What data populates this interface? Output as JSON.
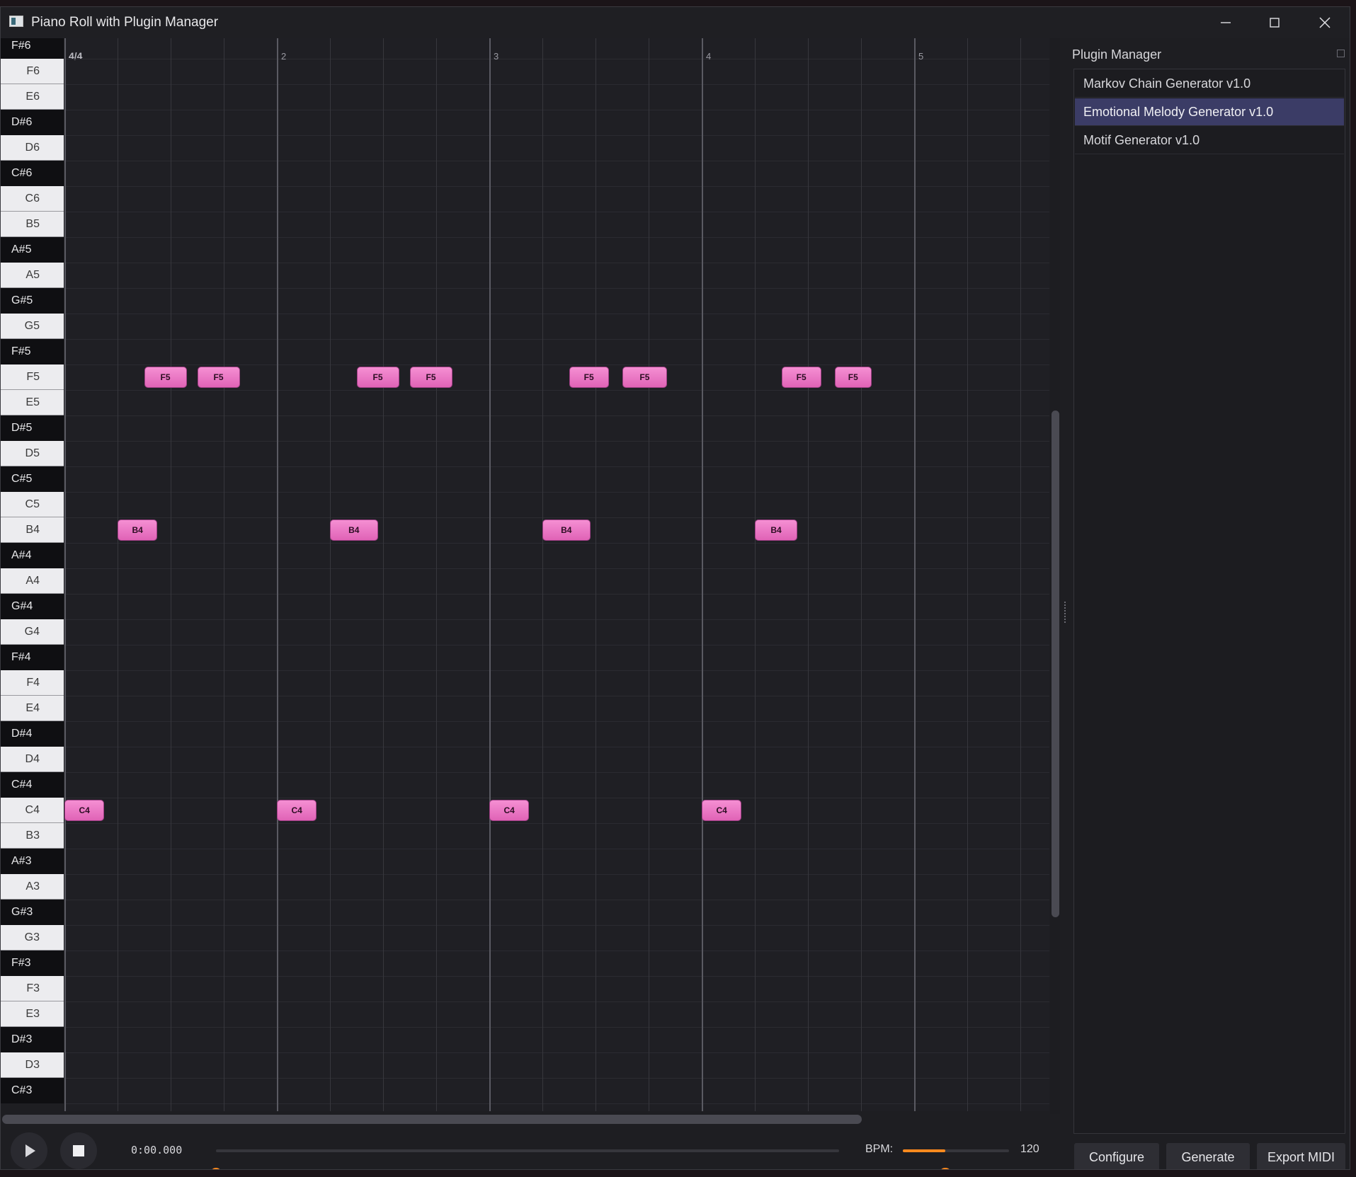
{
  "window": {
    "title": "Piano Roll with Plugin Manager",
    "controls": [
      "minimize",
      "maximize",
      "close"
    ]
  },
  "piano_roll": {
    "time_signature": "4/4",
    "bar_numbers": [
      "2",
      "3",
      "4",
      "5"
    ],
    "keys": [
      "F#6",
      "F6",
      "E6",
      "D#6",
      "D6",
      "C#6",
      "C6",
      "B5",
      "A#5",
      "A5",
      "G#5",
      "G5",
      "F#5",
      "F5",
      "E5",
      "D#5",
      "D5",
      "C#5",
      "C5",
      "B4",
      "A#4",
      "A4",
      "G#4",
      "G4",
      "F#4",
      "F4",
      "E4",
      "D#4",
      "D4",
      "C#4",
      "C4",
      "B3",
      "A#3",
      "A3",
      "G#3",
      "G3",
      "F#3",
      "F3",
      "E3",
      "D#3",
      "D3",
      "C#3"
    ],
    "notes": [
      {
        "pitch": "C4",
        "beat": 0,
        "length": 0.75
      },
      {
        "pitch": "B4",
        "beat": 1,
        "length": 0.75
      },
      {
        "pitch": "F5",
        "beat": 1.5,
        "length": 0.8
      },
      {
        "pitch": "F5",
        "beat": 2.5,
        "length": 0.8
      },
      {
        "pitch": "C4",
        "beat": 4,
        "length": 0.75
      },
      {
        "pitch": "B4",
        "beat": 5,
        "length": 0.9
      },
      {
        "pitch": "F5",
        "beat": 5.5,
        "length": 0.8
      },
      {
        "pitch": "F5",
        "beat": 6.5,
        "length": 0.8
      },
      {
        "pitch": "C4",
        "beat": 8,
        "length": 0.75
      },
      {
        "pitch": "B4",
        "beat": 9,
        "length": 0.9
      },
      {
        "pitch": "F5",
        "beat": 9.5,
        "length": 0.75
      },
      {
        "pitch": "F5",
        "beat": 10.5,
        "length": 0.85
      },
      {
        "pitch": "C4",
        "beat": 12,
        "length": 0.75
      },
      {
        "pitch": "B4",
        "beat": 13,
        "length": 0.8
      },
      {
        "pitch": "F5",
        "beat": 13.5,
        "length": 0.75
      },
      {
        "pitch": "F5",
        "beat": 14.5,
        "length": 0.7
      }
    ]
  },
  "plugin_manager": {
    "title": "Plugin Manager",
    "plugins": [
      {
        "label": "Markov Chain Generator v1.0",
        "selected": false
      },
      {
        "label": "Emotional Melody Generator v1.0",
        "selected": true
      },
      {
        "label": "Motif Generator v1.0",
        "selected": false
      }
    ],
    "buttons": {
      "configure": "Configure",
      "generate": "Generate",
      "export": "Export MIDI"
    }
  },
  "transport": {
    "time": "0:00.000",
    "position_fraction": 0.0,
    "bpm_label": "BPM:",
    "bpm_value": "120",
    "bpm_slider_fraction": 0.4
  },
  "colors": {
    "note_fill": "#eb77c5",
    "accent": "#ff8a1e",
    "selected_item": "#3b3c66",
    "background": "#1e1e22"
  },
  "icons": {
    "play": "play-icon",
    "stop": "stop-icon",
    "minimize": "minimize-icon",
    "maximize": "maximize-icon",
    "close": "close-icon"
  }
}
